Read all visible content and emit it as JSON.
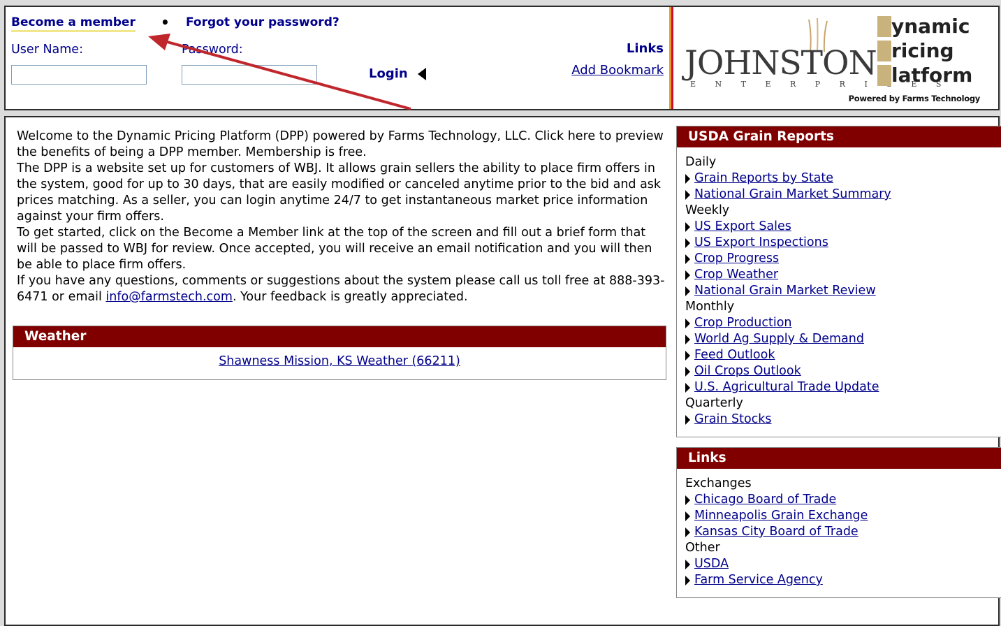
{
  "header": {
    "become_member": "Become a member",
    "bullet": "•",
    "forgot_password": "Forgot your password?",
    "user_name_label": "User Name:",
    "password_label": "Password:",
    "login_label": "Login",
    "links_heading": "Links",
    "add_bookmark": "Add Bookmark"
  },
  "logo": {
    "company": "JOHNSTON",
    "subtitle": "E N T E R P R I S E S",
    "dpp_words": [
      "ynamic",
      "ricing",
      "latform"
    ],
    "powered_by": "Powered by Farms Technology"
  },
  "welcome": {
    "p1": "Welcome to the Dynamic Pricing Platform (DPP) powered by Farms Technology, LLC. Click here to preview the benefits of being a DPP member. Membership is free.",
    "p2": "The DPP is a website set up for customers of WBJ. It allows grain sellers the ability to place firm offers in the system, good for up to 30 days, that are easily modified or canceled anytime prior to the bid and ask prices matching. As a seller, you can login anytime 24/7 to get instantaneous market price information against your firm offers.",
    "p3": "To get started, click on the Become a Member link at the top of the screen and fill out a brief form that will be passed to WBJ for review. Once accepted, you will receive an email notification and you will then be able to place firm offers.",
    "p4_before": "If you have any questions, comments or suggestions about the system please call us toll free at 888-393-6471 or email ",
    "email": "info@farmstech.com",
    "p4_after": ". Your feedback is greatly appreciated."
  },
  "weather": {
    "title": "Weather",
    "link": "Shawness Mission, KS Weather (66211)"
  },
  "usda": {
    "title": "USDA Grain Reports",
    "groups": [
      {
        "category": "Daily",
        "items": [
          "Grain Reports by State",
          "National Grain Market Summary"
        ]
      },
      {
        "category": "Weekly",
        "items": [
          "US Export Sales",
          "US Export Inspections",
          "Crop Progress",
          "Crop Weather",
          "National Grain Market Review"
        ]
      },
      {
        "category": "Monthly",
        "items": [
          "Crop Production",
          "World Ag Supply & Demand",
          "Feed Outlook",
          "Oil Crops Outlook",
          "U.S. Agricultural Trade Update"
        ]
      },
      {
        "category": "Quarterly",
        "items": [
          "Grain Stocks"
        ]
      }
    ]
  },
  "links_panel": {
    "title": "Links",
    "groups": [
      {
        "category": "Exchanges",
        "items": [
          "Chicago Board of Trade",
          "Minneapolis Grain Exchange",
          "Kansas City Board of Trade"
        ]
      },
      {
        "category": "Other",
        "items": [
          "USDA",
          "Farm Service Agency"
        ]
      }
    ]
  },
  "colors": {
    "panel_header": "#800000",
    "link": "#00008b",
    "annotation_arrow": "#c0272d"
  }
}
